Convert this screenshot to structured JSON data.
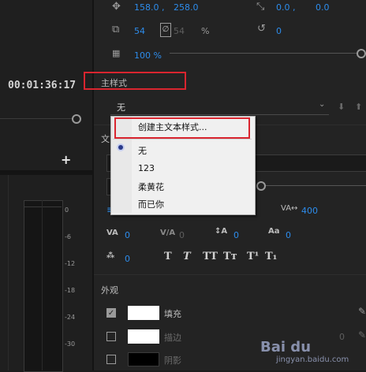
{
  "timeline": {
    "timecode": "00:01:36:17",
    "meter_ticks": [
      "0",
      "-6",
      "-12",
      "-18",
      "-24",
      "-30"
    ]
  },
  "transform": {
    "position_x": "158.0 ,",
    "position_y": "258.0",
    "anchor_x": "0.0 ,",
    "anchor_y": "0.0",
    "scale": "54",
    "scale_linked": "54",
    "scale_unit": "%",
    "rotation": "0",
    "opacity": "100 %"
  },
  "master_style": {
    "section_title": "主样式",
    "selected_value": "无"
  },
  "dropdown_menu": {
    "create_item": "创建主文本样式...",
    "options": [
      "无",
      "123",
      "柔黄花",
      "而已你"
    ]
  },
  "text_section": {
    "label": "文",
    "tracking_value": "400",
    "kerning": "0",
    "kerning2": "0",
    "leading": "0",
    "baseline": "0",
    "tsume": "0",
    "type_buttons": [
      "T",
      "T",
      "TT",
      "Tт",
      "T¹",
      "T₁"
    ]
  },
  "appearance": {
    "label": "外观",
    "fill_label": "填充",
    "stroke_label": "描边",
    "shadow_label": "阴影",
    "stroke_value": "0",
    "fill_color": "#ffffff",
    "stroke_color": "#ffffff",
    "shadow_color": "#000000"
  },
  "watermark": {
    "logo": "Bai du",
    "url": "jingyan.baidu.com"
  }
}
